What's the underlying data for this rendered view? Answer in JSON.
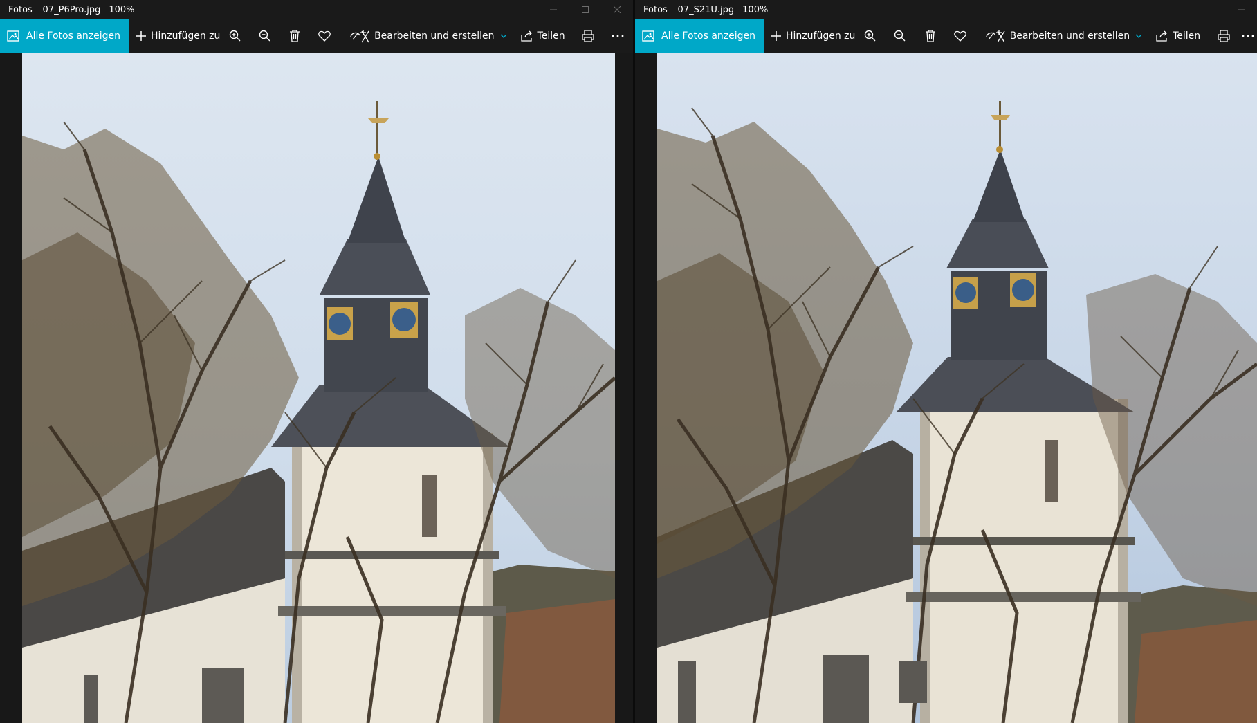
{
  "windows": [
    {
      "title": "Fotos – 07_P6Pro.jpg",
      "zoom": "100%",
      "toolbar": {
        "all_photos_label": "Alle Fotos anzeigen",
        "add_to_label": "Hinzufügen zu",
        "edit_label": "Bearbeiten und erstellen",
        "share_label": "Teilen"
      }
    },
    {
      "title": "Fotos – 07_S21U.jpg",
      "zoom": "100%",
      "toolbar": {
        "all_photos_label": "Alle Fotos anzeigen",
        "add_to_label": "Hinzufügen zu",
        "edit_label": "Bearbeiten und erstellen",
        "share_label": "Teilen"
      }
    }
  ],
  "icons": {
    "all_photos": "photo-gallery-icon",
    "add": "plus-icon",
    "zoom_in": "zoom-in-icon",
    "zoom_out": "zoom-out-icon",
    "delete": "trash-icon",
    "favorite": "heart-icon",
    "edit": "edit-create-icon",
    "share": "share-icon",
    "print": "print-icon",
    "more": "more-icon"
  },
  "colors": {
    "accent": "#00a8c8",
    "chrome": "#1a1a1a",
    "text": "#ffffff"
  }
}
